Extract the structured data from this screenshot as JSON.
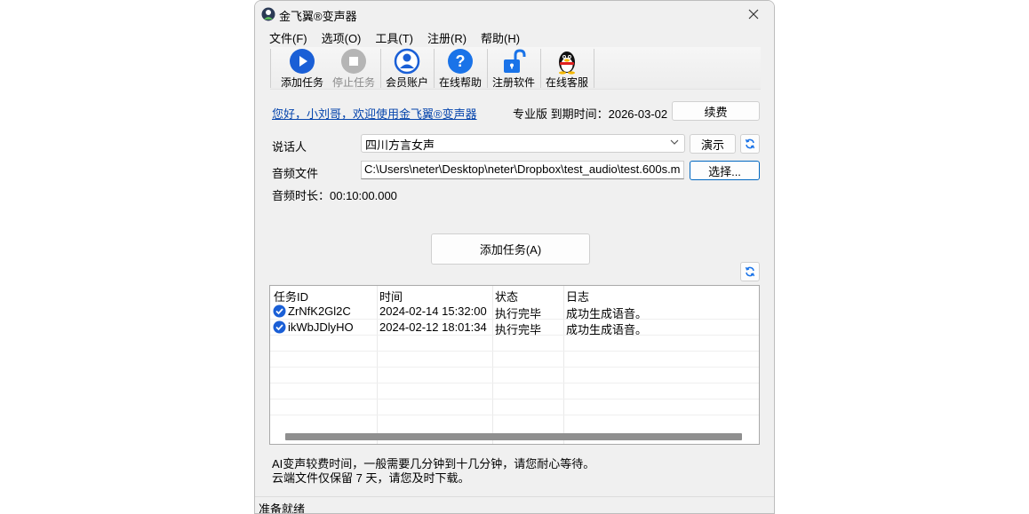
{
  "window": {
    "title": "金飞翼®变声器"
  },
  "menu": [
    "文件(F)",
    "选项(O)",
    "工具(T)",
    "注册(R)",
    "帮助(H)"
  ],
  "toolbar": {
    "add_task": "添加任务",
    "stop_task": "停止任务",
    "account": "会员账户",
    "online_help": "在线帮助",
    "register": "注册软件",
    "support": "在线客服"
  },
  "welcome": "您好，小刘哥，欢迎使用金飞翼®变声器",
  "version": "专业版 到期时间：2026-03-02",
  "renew_label": "续费",
  "speaker": {
    "label": "说话人",
    "value": "四川方言女声",
    "demo_label": "演示"
  },
  "audio_file": {
    "label": "音频文件",
    "value": "C:\\Users\\neter\\Desktop\\neter\\Dropbox\\test_audio\\test.600s.m",
    "choose_label": "选择..."
  },
  "duration": "音频时长：00:10:00.000",
  "add_task_button": "添加任务(A)",
  "table": {
    "columns": [
      "任务ID",
      "时间",
      "状态",
      "日志"
    ],
    "rows": [
      {
        "id": "ZrNfK2Gl2C",
        "time": "2024-02-14 15:32:00",
        "status": "执行完毕",
        "log": "成功生成语音。"
      },
      {
        "id": "ikWbJDlyHO",
        "time": "2024-02-12 18:01:34",
        "status": "执行完毕",
        "log": "成功生成语音。"
      }
    ]
  },
  "notes": [
    "AI变声较费时间，一般需要几分钟到十几分钟，请您耐心等待。",
    "云端文件仅保留 7 天，请您及时下载。"
  ],
  "status": "准备就绪",
  "colors": {
    "accent": "#1a73e8",
    "link": "#0645ad",
    "checkmark": "#1a5fd6"
  }
}
